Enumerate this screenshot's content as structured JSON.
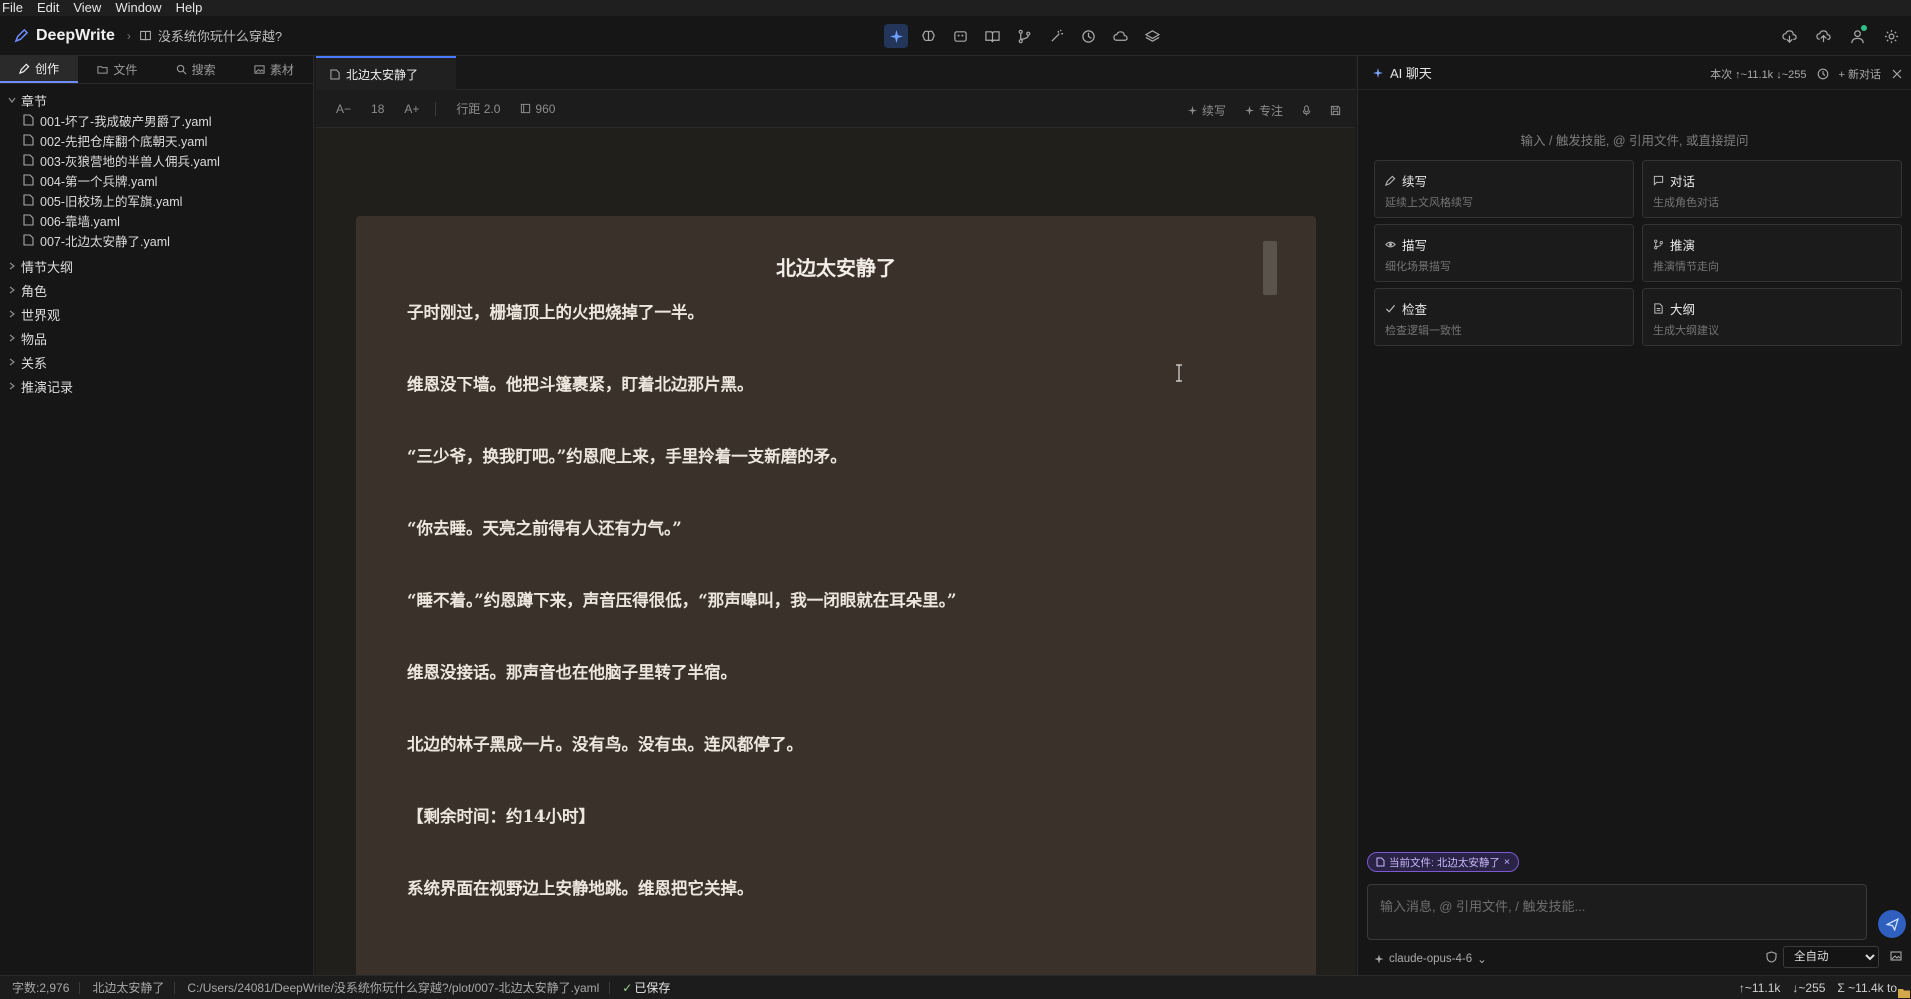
{
  "menu": [
    "File",
    "Edit",
    "View",
    "Window",
    "Help"
  ],
  "app": {
    "name": "DeepWrite",
    "project": "没系统你玩什么穿越?"
  },
  "sidebar": {
    "tabs": [
      {
        "label": "创作",
        "icon": "pen-icon",
        "active": true
      },
      {
        "label": "文件",
        "icon": "folder-icon"
      },
      {
        "label": "搜索",
        "icon": "search-icon"
      },
      {
        "label": "素材",
        "icon": "image-icon"
      }
    ],
    "chapters_label": "章节",
    "chapters": [
      "001-坏了-我成破产男爵了.yaml",
      "002-先把仓库翻个底朝天.yaml",
      "003-灰狼营地的半兽人佣兵.yaml",
      "004-第一个兵牌.yaml",
      "005-旧校场上的军旗.yaml",
      "006-靠墙.yaml",
      "007-北边太安静了.yaml"
    ],
    "groups": [
      "情节大纲",
      "角色",
      "世界观",
      "物品",
      "关系",
      "推演记录"
    ]
  },
  "editor": {
    "tab_title": "北边太安静了",
    "toolbar": {
      "font_decrease": "A−",
      "font_size": "18",
      "font_increase": "A+",
      "line_height": "行距 2.0",
      "width": "960",
      "continue": "续写",
      "focus": "专注"
    },
    "doc_title": "北边太安静了",
    "paragraphs": [
      "子时刚过，栅墙顶上的火把烧掉了一半。",
      "维恩没下墙。他把斗篷裹紧，盯着北边那片黑。",
      "“三少爷，换我盯吧。”约恩爬上来，手里拎着一支新磨的矛。",
      "“你去睡。天亮之前得有人还有力气。”",
      "“睡不着。”约恩蹲下来，声音压得很低，“那声嗥叫，我一闭眼就在耳朵里。”",
      "维恩没接话。那声音也在他脑子里转了半宿。",
      "北边的林子黑成一片。没有鸟。没有虫。连风都停了。",
      "【剩余时间：约14小时】",
      "系统界面在视野边上安静地跳。维恩把它关掉。"
    ]
  },
  "ai_panel": {
    "title": "AI 聊天",
    "usage": "本次 ↑~11.1k ↓~255",
    "new_chat": "+ 新对话",
    "hint": "输入 / 触发技能, @ 引用文件, 或直接提问",
    "skills": [
      {
        "title": "续写",
        "desc": "延续上文风格续写",
        "icon": "pencil-icon"
      },
      {
        "title": "对话",
        "desc": "生成角色对话",
        "icon": "chat-bubble-icon"
      },
      {
        "title": "描写",
        "desc": "细化场景描写",
        "icon": "eye-icon"
      },
      {
        "title": "推演",
        "desc": "推演情节走向",
        "icon": "branch-icon"
      },
      {
        "title": "检查",
        "desc": "检查逻辑一致性",
        "icon": "check-icon"
      },
      {
        "title": "大纲",
        "desc": "生成大纲建议",
        "icon": "document-icon"
      }
    ],
    "context_chip": "当前文件: 北边太安静了",
    "input_placeholder": "输入消息, @ 引用文件, / 触发技能...",
    "model": "claude-opus-4-6",
    "mode_selected": "全自动"
  },
  "status": {
    "word_count": "字数:2,976",
    "file": "北边太安静了",
    "path": "C:/Users/24081/DeepWrite/没系统你玩什么穿越?/plot/007-北边太安静了.yaml",
    "saved": "已保存",
    "tokens_up": "↑~11.1k",
    "tokens_down": "↓~255",
    "tokens_total": "Σ ~11.4k to"
  },
  "colors": {
    "accent": "#6d8dff",
    "paper": "#3a322a",
    "chip_border": "#7a5bd1",
    "send": "#2f5fbf"
  }
}
